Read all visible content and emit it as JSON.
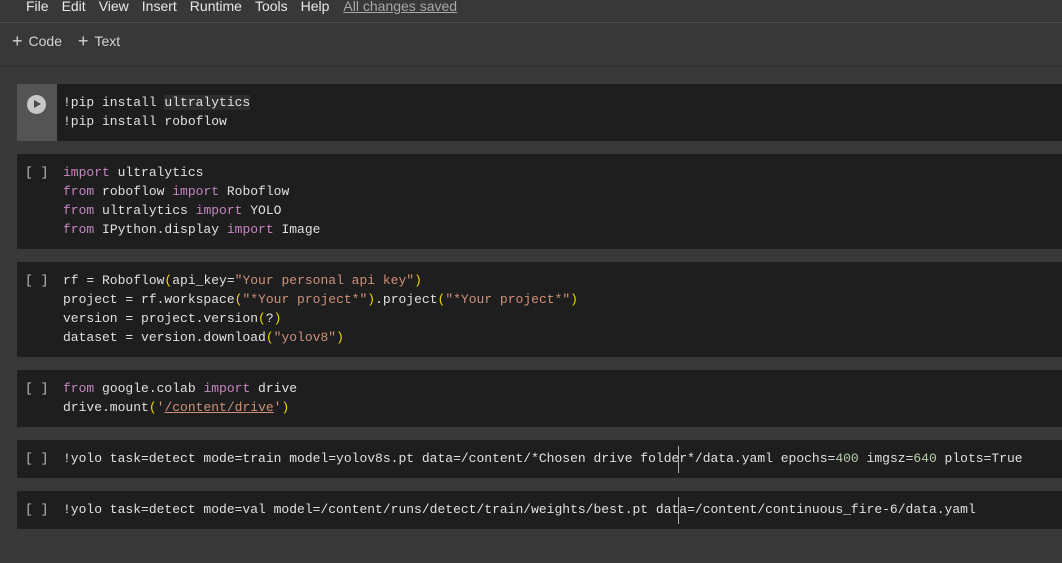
{
  "menu": {
    "items": [
      "File",
      "Edit",
      "View",
      "Insert",
      "Runtime",
      "Tools",
      "Help"
    ],
    "status": "All changes saved"
  },
  "toolbar": {
    "code_label": "Code",
    "text_label": "Text",
    "plus_glyph": "+"
  },
  "cells": [
    {
      "bracket": "",
      "lines": [
        [
          {
            "t": "!pip install ",
            "c": ""
          },
          {
            "t": "ultralytics",
            "c": "hl"
          }
        ],
        [
          {
            "t": "!pip install roboflow",
            "c": ""
          }
        ]
      ]
    },
    {
      "bracket": "[ ]",
      "lines": [
        [
          {
            "t": "import",
            "c": "kw"
          },
          {
            "t": " ultralytics",
            "c": ""
          }
        ],
        [
          {
            "t": "from",
            "c": "kw"
          },
          {
            "t": " roboflow ",
            "c": ""
          },
          {
            "t": "import",
            "c": "kw"
          },
          {
            "t": " Roboflow",
            "c": ""
          }
        ],
        [
          {
            "t": "from",
            "c": "kw"
          },
          {
            "t": " ultralytics ",
            "c": ""
          },
          {
            "t": "import",
            "c": "kw"
          },
          {
            "t": " YOLO",
            "c": ""
          }
        ],
        [
          {
            "t": "from",
            "c": "kw"
          },
          {
            "t": " IPython.display ",
            "c": ""
          },
          {
            "t": "import",
            "c": "kw"
          },
          {
            "t": " Image",
            "c": ""
          }
        ]
      ]
    },
    {
      "bracket": "[ ]",
      "lines": [
        [
          {
            "t": "rf = Roboflow",
            "c": ""
          },
          {
            "t": "(",
            "c": "par"
          },
          {
            "t": "api_key=",
            "c": ""
          },
          {
            "t": "\"Your personal api key\"",
            "c": "str"
          },
          {
            "t": ")",
            "c": "par"
          }
        ],
        [
          {
            "t": "project = rf.workspace",
            "c": ""
          },
          {
            "t": "(",
            "c": "par"
          },
          {
            "t": "\"*Your project*\"",
            "c": "str"
          },
          {
            "t": ")",
            "c": "par"
          },
          {
            "t": ".project",
            "c": ""
          },
          {
            "t": "(",
            "c": "par"
          },
          {
            "t": "\"*Your project*\"",
            "c": "str"
          },
          {
            "t": ")",
            "c": "par"
          }
        ],
        [
          {
            "t": "version = project.version",
            "c": ""
          },
          {
            "t": "(",
            "c": "par"
          },
          {
            "t": "?",
            "c": ""
          },
          {
            "t": ")",
            "c": "par"
          }
        ],
        [
          {
            "t": "dataset = version.download",
            "c": ""
          },
          {
            "t": "(",
            "c": "par"
          },
          {
            "t": "\"yolov8\"",
            "c": "str"
          },
          {
            "t": ")",
            "c": "par"
          }
        ]
      ]
    },
    {
      "bracket": "[ ]",
      "lines": [
        [
          {
            "t": "from",
            "c": "kw"
          },
          {
            "t": " google.colab ",
            "c": ""
          },
          {
            "t": "import",
            "c": "kw"
          },
          {
            "t": " drive",
            "c": ""
          }
        ],
        [
          {
            "t": "drive.mount",
            "c": ""
          },
          {
            "t": "(",
            "c": "par"
          },
          {
            "t": "'",
            "c": "str"
          },
          {
            "t": "/content/drive",
            "c": "str uline"
          },
          {
            "t": "'",
            "c": "str"
          },
          {
            "t": ")",
            "c": "par"
          }
        ]
      ]
    },
    {
      "bracket": "[ ]",
      "lines": [
        [
          {
            "t": "!yolo task=detect mode=train model=yolov8s.pt data=/content/*Chosen drive folder*/data.yaml epochs=",
            "c": ""
          },
          {
            "t": "400",
            "c": "num"
          },
          {
            "t": " imgsz=",
            "c": ""
          },
          {
            "t": "640",
            "c": "num"
          },
          {
            "t": " plots=True",
            "c": ""
          }
        ]
      ]
    },
    {
      "bracket": "[ ]",
      "lines": [
        [
          {
            "t": "!yolo task=detect mode=val model=/content/runs/detect/train/weights/best.pt data=/content/continuous_fire-6/data.yaml",
            "c": ""
          }
        ]
      ]
    }
  ]
}
